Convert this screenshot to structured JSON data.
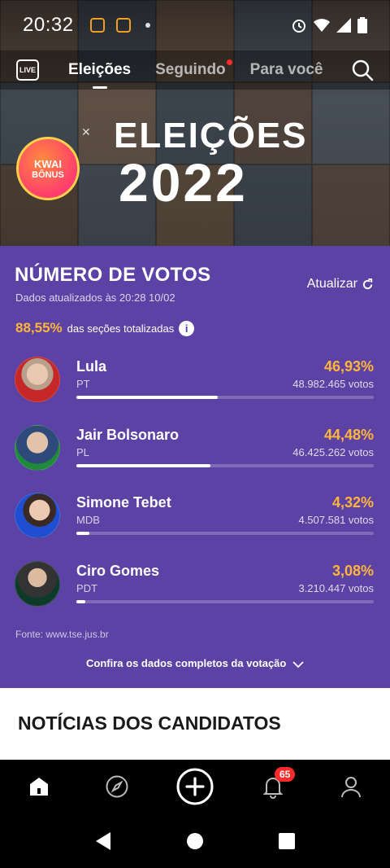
{
  "status_bar": {
    "time": "20:32"
  },
  "top_nav": {
    "live_label": "LIVE",
    "tabs": [
      {
        "label": "Eleições",
        "active": true
      },
      {
        "label": "Seguindo",
        "active": false,
        "has_dot": true
      },
      {
        "label": "Para você",
        "active": false
      }
    ]
  },
  "hero": {
    "title_line1": "ELEIÇÕES",
    "title_line2": "2022"
  },
  "kwai_bonus": {
    "line1": "KWAI",
    "line2": "BÔNUS"
  },
  "votes": {
    "title": "NÚMERO DE VOTOS",
    "updated": "Dados atualizados às 20:28 10/02",
    "refresh_label": "Atualizar",
    "sections_pct": "88,55%",
    "sections_label": "das seções totalizadas",
    "candidates": [
      {
        "name": "Lula",
        "party": "PT",
        "percent": "46,93%",
        "votes": "48.982.465 votos",
        "share": 0.4693
      },
      {
        "name": "Jair Bolsonaro",
        "party": "PL",
        "percent": "44,48%",
        "votes": "46.425.262 votos",
        "share": 0.4448
      },
      {
        "name": "Simone Tebet",
        "party": "MDB",
        "percent": "4,32%",
        "votes": "4.507.581 votos",
        "share": 0.0432
      },
      {
        "name": "Ciro Gomes",
        "party": "PDT",
        "percent": "3,08%",
        "votes": "3.210.447 votos",
        "share": 0.0308
      }
    ],
    "source": "Fonte: www.tse.jus.br",
    "full_data_link": "Confira os dados completos da votação"
  },
  "news": {
    "title": "NOTÍCIAS DOS CANDIDATOS"
  },
  "bottom_nav": {
    "notifications_badge": "65"
  },
  "colors": {
    "panel": "#5c42a4",
    "accent_orange": "#ffb53a",
    "badge_red": "#ff2a2a"
  }
}
